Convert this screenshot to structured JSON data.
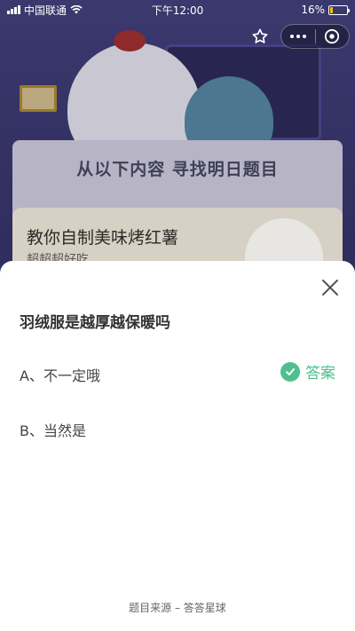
{
  "status_bar": {
    "carrier": "中国联通",
    "time": "下午12:00",
    "battery_percent": "16%",
    "battery_level": 0.16
  },
  "background": {
    "banner_title": "从以下内容  寻找明日题目",
    "card_title": "教你自制美味烤红薯",
    "card_subtitle": "超超超好吃"
  },
  "sheet": {
    "question": "羽绒服是越厚越保暖吗",
    "options": [
      {
        "label": "A、不一定哦",
        "is_answer": true
      },
      {
        "label": "B、当然是",
        "is_answer": false
      }
    ],
    "answer_label": "答案",
    "source": "题目来源 – 答答星球"
  },
  "colors": {
    "accent_green": "#4fc08d",
    "text_dark": "#333333"
  },
  "icons": {
    "favorite": "star-outline-icon",
    "more": "more-dots-icon",
    "close_miniprogram": "circle-close-icon",
    "close_sheet": "close-x-icon",
    "answer_check": "check-circle-icon"
  }
}
